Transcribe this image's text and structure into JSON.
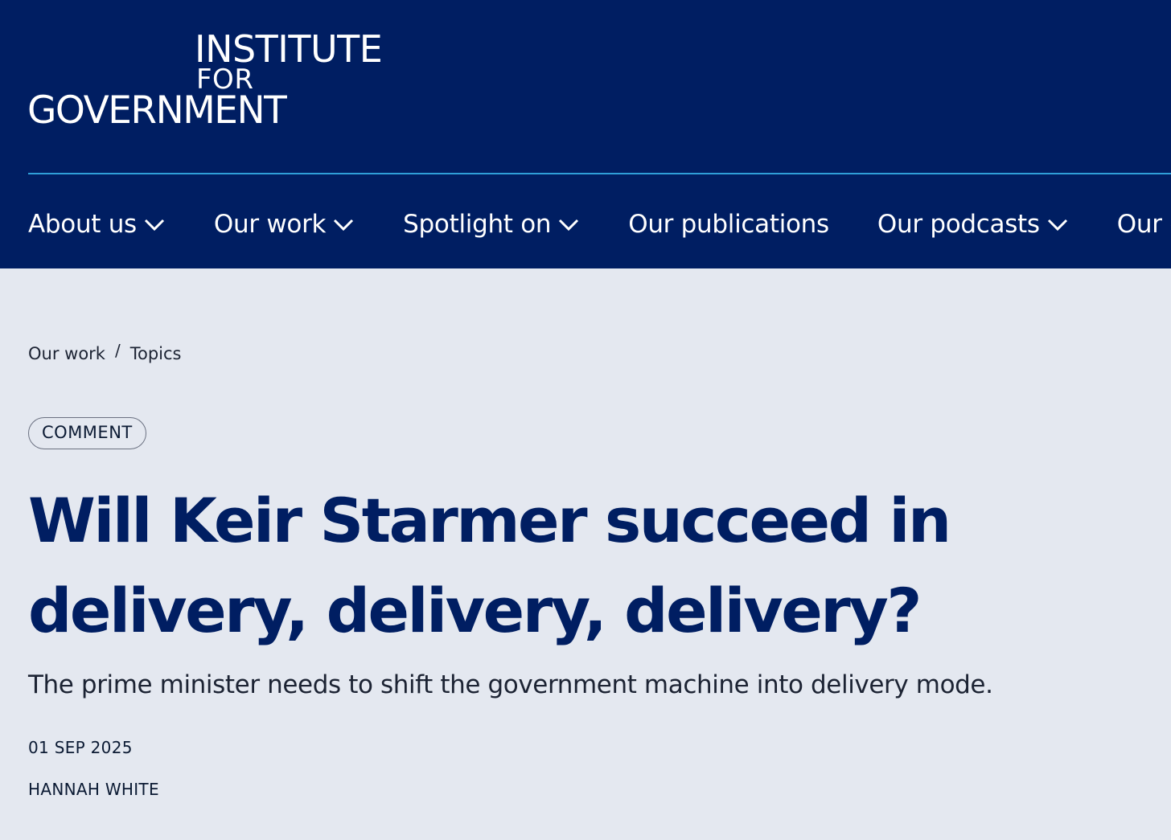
{
  "header": {
    "logo": {
      "line1": "INSTITUTE",
      "line2": "FOR",
      "line3": "GOVERNMENT"
    },
    "nav": [
      {
        "label": "About us",
        "has_dropdown": true
      },
      {
        "label": "Our work",
        "has_dropdown": true
      },
      {
        "label": "Spotlight on",
        "has_dropdown": true
      },
      {
        "label": "Our publications",
        "has_dropdown": false
      },
      {
        "label": "Our podcasts",
        "has_dropdown": true
      },
      {
        "label": "Our e",
        "has_dropdown": false
      }
    ]
  },
  "breadcrumb": {
    "items": [
      "Our work",
      "Topics"
    ],
    "separator": "/"
  },
  "article": {
    "tag": "COMMENT",
    "title": "Will Keir Starmer succeed in delivery, delivery, delivery?",
    "standfirst": "The prime minister needs to shift the government machine into delivery mode.",
    "date": "01 SEP 2025",
    "author": "HANNAH WHITE"
  },
  "colors": {
    "header_bg": "#001e62",
    "header_rule": "#2f9fd8",
    "page_bg": "#e4e8f0",
    "headline": "#001e62"
  }
}
